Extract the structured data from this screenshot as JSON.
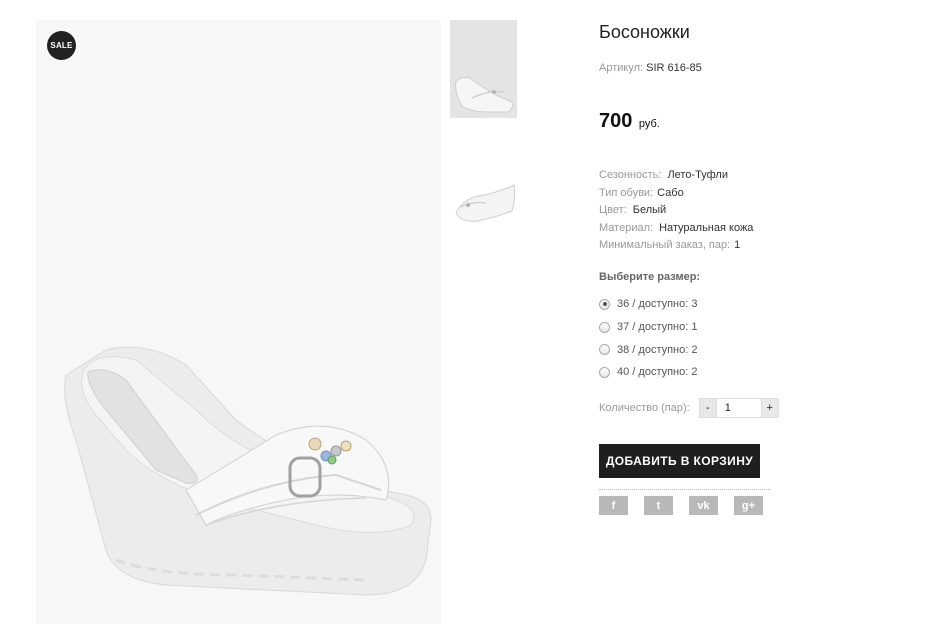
{
  "product": {
    "title": "Босоножки",
    "sku_label": "Артикул:",
    "sku_value": "SIR 616-85",
    "price": "700",
    "currency": "руб.",
    "sale_badge": "SALE"
  },
  "properties": [
    {
      "key": "Сезонность:",
      "value": "Лето-Туфли"
    },
    {
      "key": "Тип обуви:",
      "value": "Сабо"
    },
    {
      "key": "Цвет:",
      "value": "Белый"
    },
    {
      "key": "Материал:",
      "value": "Натуральная кожа"
    },
    {
      "key": "Минимальный заказ, пар:",
      "value": "1"
    }
  ],
  "sizes": {
    "title": "Выберите размер:",
    "options": [
      {
        "label": "36 / доступно: 3",
        "checked": true
      },
      {
        "label": "37 / доступно: 1",
        "checked": false
      },
      {
        "label": "38 / доступно: 2",
        "checked": false
      },
      {
        "label": "40 / доступно: 2",
        "checked": false
      }
    ]
  },
  "quantity": {
    "label": "Количество (пар):",
    "minus": "-",
    "value": "1",
    "plus": "+"
  },
  "cart": {
    "button_label": "ДОБАВИТЬ В КОРЗИНУ"
  },
  "social": [
    {
      "name": "facebook-icon",
      "glyph": "f"
    },
    {
      "name": "twitter-icon",
      "glyph": "t"
    },
    {
      "name": "vk-icon",
      "glyph": "vk"
    },
    {
      "name": "google-plus-icon",
      "glyph": "g+"
    }
  ]
}
